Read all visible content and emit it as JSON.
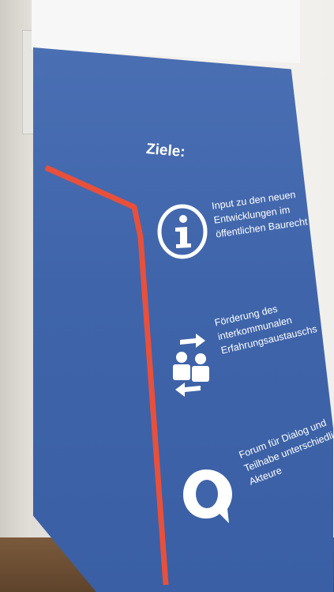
{
  "banner": {
    "title": "Ziele:",
    "goals": [
      {
        "icon": "info-icon",
        "lines": [
          "Input zu den neuen",
          "Entwicklungen im",
          "öffentlichen Baurecht"
        ]
      },
      {
        "icon": "exchange-people-icon",
        "lines": [
          "Förderung des",
          "interkommunalen",
          "Erfahrungsaustauschs"
        ]
      },
      {
        "icon": "speech-bubble-icon",
        "lines": [
          "Forum für Dialog und",
          "Teilhabe unterschiedlicher",
          "Akteure"
        ]
      }
    ],
    "colors": {
      "banner_blue": "#3f64aa",
      "accent_red": "#e8503c",
      "text_white": "#ffffff"
    }
  }
}
